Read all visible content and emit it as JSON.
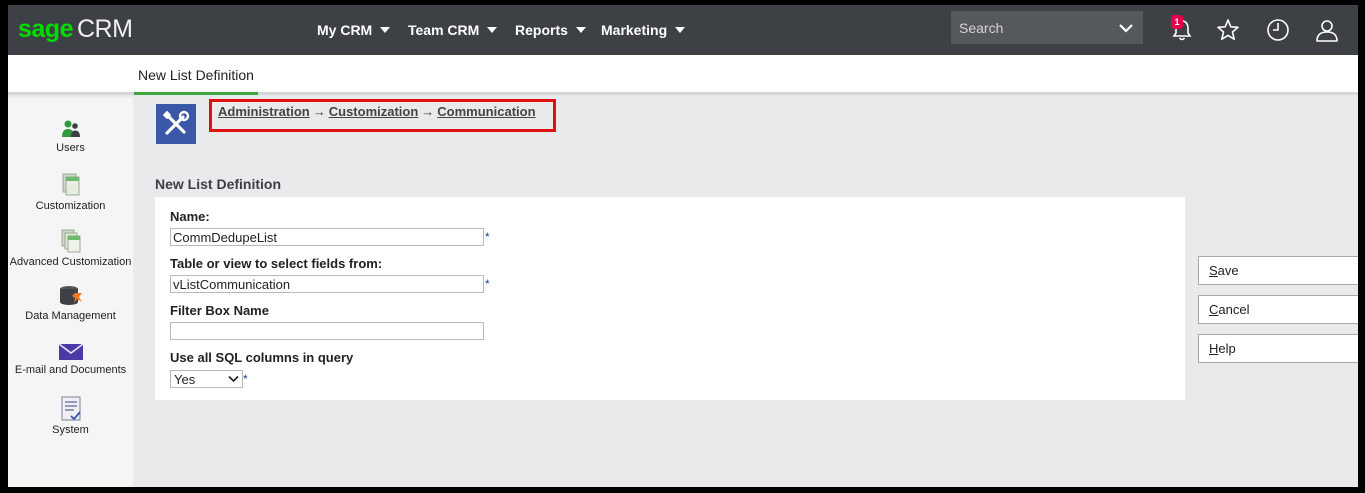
{
  "app": {
    "logo_brand": "sage",
    "logo_product": "CRM"
  },
  "header": {
    "menus": [
      {
        "label": "My CRM"
      },
      {
        "label": "Team CRM"
      },
      {
        "label": "Reports"
      },
      {
        "label": "Marketing"
      }
    ],
    "search": {
      "placeholder": "Search",
      "value": ""
    },
    "notifications_count": "1",
    "icons": [
      "bell-icon",
      "star-icon",
      "clock-icon",
      "user-icon"
    ]
  },
  "tab": {
    "label": "New List Definition"
  },
  "sidebar": {
    "items": [
      {
        "label": "Users",
        "icon": "users-icon"
      },
      {
        "label": "Customization",
        "icon": "customization-icon"
      },
      {
        "label": "Advanced Customization",
        "icon": "advanced-customization-icon"
      },
      {
        "label": "Data Management",
        "icon": "data-management-icon"
      },
      {
        "label": "E-mail and Documents",
        "icon": "envelope-icon"
      },
      {
        "label": "System",
        "icon": "system-icon"
      }
    ]
  },
  "breadcrumb": {
    "items": [
      "Administration",
      "Customization",
      "Communication"
    ],
    "separator": "→"
  },
  "form": {
    "title": "New List Definition",
    "name_label": "Name:",
    "name_value": "CommDedupeList",
    "table_label": "Table or view to select fields from:",
    "table_value": "vListCommunication",
    "filter_label": "Filter Box Name",
    "filter_value": "",
    "sql_label": "Use all SQL columns in query",
    "sql_value": "Yes",
    "required_mark": "*"
  },
  "actions": {
    "save_first": "S",
    "save_rest": "ave",
    "cancel_first": "C",
    "cancel_rest": "ancel",
    "help_first": "H",
    "help_rest": "elp"
  },
  "colors": {
    "topbar": "#3d4145",
    "accent_green": "#3caa3c",
    "highlight_red": "#e01010",
    "admin_icon_bg": "#3a57a8"
  }
}
